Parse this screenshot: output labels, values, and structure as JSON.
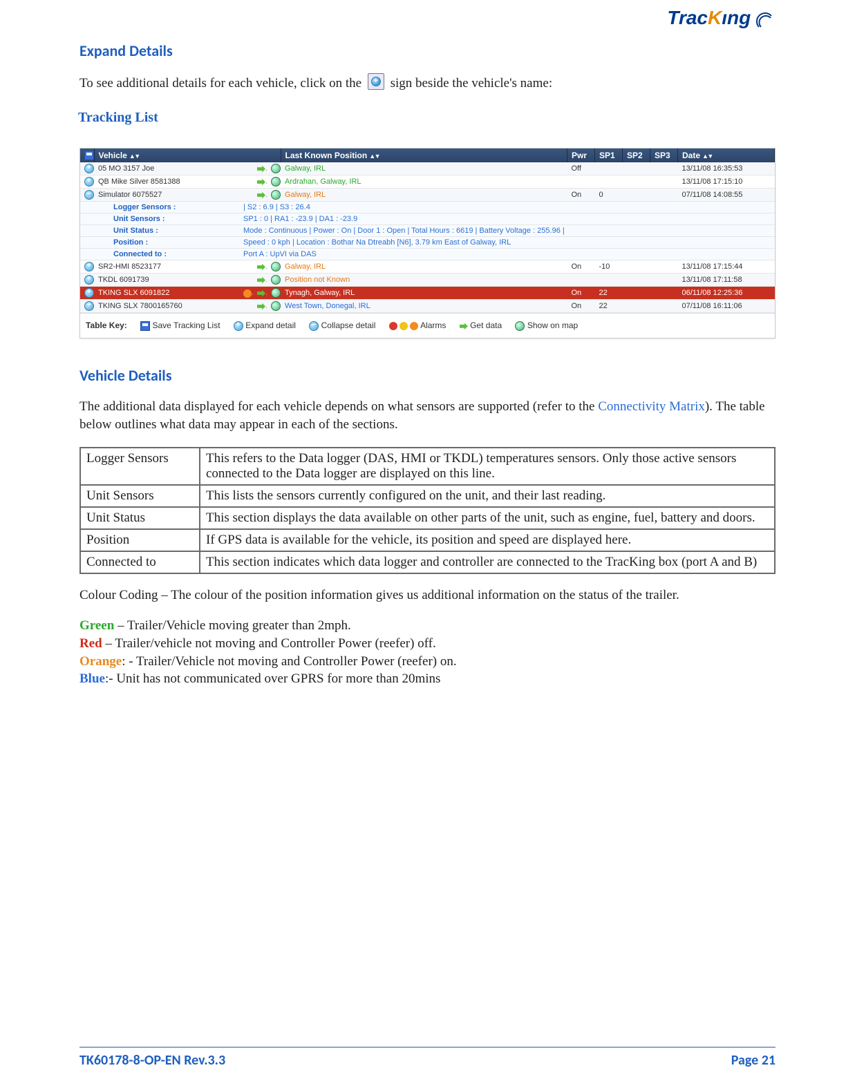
{
  "logo": {
    "part1": "Trac",
    "part2": "K",
    "part3": "ıng"
  },
  "section1_title": "Expand Details",
  "intro_pre": "To see additional details for each vehicle, click on the ",
  "intro_post": " sign beside the vehicle's name:",
  "shot_title": "Tracking List",
  "grid": {
    "headers": {
      "vehicle": "Vehicle",
      "position": "Last Known Position",
      "pwr": "Pwr",
      "sp1": "SP1",
      "sp2": "SP2",
      "sp3": "SP3",
      "date": "Date"
    },
    "sort": "▲  ▼",
    "rows": [
      {
        "vehicle": "05 MO 3157 Joe",
        "pos": "Galway, IRL",
        "pos_cls": "pos-green",
        "pwr": "Off",
        "sp1": "",
        "sp2": "",
        "sp3": "",
        "date": "13/11/08 16:35:53",
        "hl": false
      },
      {
        "vehicle": "QB Mike Silver 8581388",
        "pos": "Ardrahan, Galway, IRL",
        "pos_cls": "pos-green",
        "pwr": "",
        "sp1": "",
        "sp2": "",
        "sp3": "",
        "date": "13/11/08 17:15:10",
        "hl": false
      },
      {
        "vehicle": "Simulator 6075527",
        "pos": "Galway, IRL",
        "pos_cls": "pos-orange",
        "pwr": "On",
        "sp1": "0",
        "sp2": "",
        "sp3": "",
        "date": "07/11/08 14:08:55",
        "hl": false,
        "expanded": true
      },
      {
        "vehicle": "SR2-HMI 8523177",
        "pos": "Galway, IRL",
        "pos_cls": "pos-orange",
        "pwr": "On",
        "sp1": "-10",
        "sp2": "",
        "sp3": "",
        "date": "13/11/08 17:15:44",
        "hl": false
      },
      {
        "vehicle": "TKDL 6091739",
        "pos": "Position not Known",
        "pos_cls": "pos-orange",
        "pwr": "",
        "sp1": "",
        "sp2": "",
        "sp3": "",
        "date": "13/11/08 17:11:58",
        "hl": false
      },
      {
        "vehicle": "TKING SLX 6091822",
        "pos": "Tynagh, Galway, IRL",
        "pos_cls": "pos-orange",
        "pwr": "On",
        "sp1": "22",
        "sp2": "",
        "sp3": "",
        "date": "06/11/08 12:25:36",
        "hl": true
      },
      {
        "vehicle": "TKING SLX 7800165760",
        "pos": "West Town, Donegal, IRL",
        "pos_cls": "pos-blue",
        "pwr": "On",
        "sp1": "22",
        "sp2": "",
        "sp3": "",
        "date": "07/11/08 16:11:06",
        "hl": false
      }
    ],
    "details": [
      {
        "label": "Logger Sensors :",
        "value": "| S2 : 6.9 | S3 : 26.4"
      },
      {
        "label": "Unit Sensors :",
        "value": "SP1 : 0 | RA1 : -23.9 | DA1 : -23.9"
      },
      {
        "label": "Unit Status :",
        "value": "Mode : Continuous | Power : On | Door 1 : Open | Total Hours : 6619 | Battery Voltage : 255.96 |"
      },
      {
        "label": "Position :",
        "value": "Speed : 0 kph | Location : Bothar Na Dtreabh [N6], 3.79 km East of Galway, IRL"
      },
      {
        "label": "Connected to :",
        "value": "Port A :  UpVI  via DAS"
      }
    ],
    "key": {
      "label": "Table Key:",
      "save": "Save Tracking List",
      "expand": "Expand detail",
      "collapse": "Collapse detail",
      "alarms": "Alarms",
      "getdata": "Get data",
      "showmap": "Show on map"
    }
  },
  "section2_title": "Vehicle Details",
  "section2_intro_a": "The additional data displayed for each vehicle depends on what sensors are supported (refer to the ",
  "section2_intro_link": "Connectivity Matrix",
  "section2_intro_b": "). The table below outlines what data may appear in each of the sections.",
  "def_rows": [
    {
      "k": "Logger Sensors",
      "v": "This refers to the Data logger (DAS, HMI or TKDL) temperatures sensors. Only those active sensors connected to the Data logger are displayed on this line."
    },
    {
      "k": "Unit Sensors",
      "v": "This lists the sensors currently configured on the unit, and their last reading."
    },
    {
      "k": "Unit Status",
      "v": "This section displays the data available on other parts of the unit, such as engine, fuel, battery and doors."
    },
    {
      "k": "Position",
      "v": "If GPS data is available for the vehicle, its position and speed are displayed here."
    },
    {
      "k": "Connected to",
      "v": "This section indicates which data logger and controller are connected to the TracKing box (port A and B)"
    }
  ],
  "colour_intro": "Colour Coding – The colour of the position information gives us additional information on the status of the trailer.",
  "cc": [
    {
      "lab": "Green",
      "cls": "cc-green",
      "sep": " – ",
      "txt": "Trailer/Vehicle moving greater than 2mph."
    },
    {
      "lab": "Red",
      "cls": "cc-red",
      "sep": " – ",
      "txt": "Trailer/vehicle not moving and Controller Power (reefer) off."
    },
    {
      "lab": "Orange",
      "cls": "cc-orange",
      "sep": ": - ",
      "txt": "Trailer/Vehicle not moving and Controller Power (reefer) on."
    },
    {
      "lab": "Blue",
      "cls": "cc-blue",
      "sep": ":-  ",
      "txt": "Unit has not communicated over GPRS for more than 20mins"
    }
  ],
  "footer": {
    "left": "TK60178-8-OP-EN Rev.3.3",
    "right": "Page  21"
  }
}
